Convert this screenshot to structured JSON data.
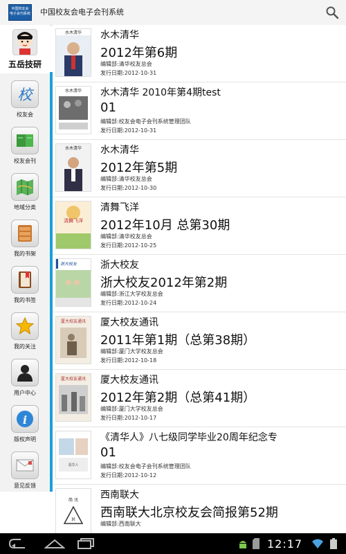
{
  "app": {
    "title": "中国校友会电子会刊系统",
    "logo_text": "中国校友会电子会刊系统"
  },
  "user": {
    "name": "五岳技研"
  },
  "sidebar": {
    "items": [
      {
        "label": "校友会",
        "icon": "xiao-char-icon"
      },
      {
        "label": "校友会刊",
        "icon": "book-icon"
      },
      {
        "label": "地域分类",
        "icon": "map-icon"
      },
      {
        "label": "我的书架",
        "icon": "bookshelf-icon"
      },
      {
        "label": "我的书签",
        "icon": "bookmark-icon"
      },
      {
        "label": "我的关注",
        "icon": "star-icon"
      },
      {
        "label": "用户中心",
        "icon": "user-icon"
      },
      {
        "label": "版权声明",
        "icon": "info-icon"
      },
      {
        "label": "意见反馈",
        "icon": "mail-icon"
      }
    ]
  },
  "list": [
    {
      "name": "水木清华",
      "issue": "2012年第6期",
      "editor": "编辑部:清华校友总会",
      "date": "发行日期:2012-10-31"
    },
    {
      "name": "水木清华  2010年第4期test",
      "issue": "01",
      "editor": "编辑部:校友会电子会刊系统管理团队",
      "date": "发行日期:2012-10-31"
    },
    {
      "name": "水木清华",
      "issue": "2012年第5期",
      "editor": "编辑部:清华校友总会",
      "date": "发行日期:2012-10-30"
    },
    {
      "name": "清舞飞洋",
      "issue": "2012年10月 总第30期",
      "editor": "编辑部:清华校友总会",
      "date": "发行日期:2012-10-25"
    },
    {
      "name": "浙大校友",
      "issue": "浙大校友2012年第2期",
      "editor": "编辑部:浙江大学校友总会",
      "date": "发行日期:2012-10-24"
    },
    {
      "name": "厦大校友通讯",
      "issue": "2011年第1期（总第38期）",
      "editor": "编辑部:厦门大学校友总会",
      "date": "发行日期:2012-10-18"
    },
    {
      "name": "厦大校友通讯",
      "issue": "2012年第2期（总第41期）",
      "editor": "编辑部:厦门大学校友总会",
      "date": "发行日期:2012-10-17"
    },
    {
      "name": "《清华人》八七级同学毕业20周年纪念专",
      "issue": "01",
      "editor": "编辑部:校友会电子会刊系统管理团队",
      "date": "发行日期:2012-10-12"
    },
    {
      "name": "西南联大",
      "issue": "西南联大北京校友会简报第52期",
      "editor": "编辑部:西南联大",
      "date": ""
    }
  ],
  "status_bar": {
    "time": "12:17"
  },
  "colors": {
    "accent": "#1aa0d8",
    "navbar": "#000000",
    "app_logo": "#1d5fa6"
  }
}
